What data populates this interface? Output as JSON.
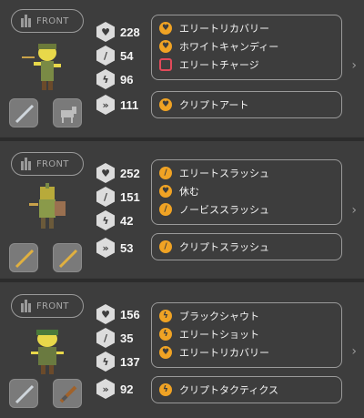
{
  "units": [
    {
      "position_label": "FRONT",
      "stats": {
        "hp": "228",
        "atk": "54",
        "spd": "96",
        "crit": "111"
      },
      "skills": [
        {
          "label": "エリートリカバリー",
          "icon": "heart-icon"
        },
        {
          "label": "ホワイトキャンディー",
          "icon": "heart-icon"
        },
        {
          "label": "エリートチャージ",
          "icon": "charge-icon"
        }
      ],
      "crypt_skill": {
        "label": "クリプトアート",
        "icon": "heart-icon"
      }
    },
    {
      "position_label": "FRONT",
      "stats": {
        "hp": "252",
        "atk": "151",
        "spd": "42",
        "crit": "53"
      },
      "skills": [
        {
          "label": "エリートスラッシュ",
          "icon": "sword-icon"
        },
        {
          "label": "休む",
          "icon": "heart-icon"
        },
        {
          "label": "ノービススラッシュ",
          "icon": "sword-icon"
        }
      ],
      "crypt_skill": {
        "label": "クリプトスラッシュ",
        "icon": "sword-icon"
      }
    },
    {
      "position_label": "FRONT",
      "stats": {
        "hp": "156",
        "atk": "35",
        "spd": "137",
        "crit": "92"
      },
      "skills": [
        {
          "label": "ブラックシャウト",
          "icon": "bolt-icon"
        },
        {
          "label": "エリートショット",
          "icon": "bolt-icon"
        },
        {
          "label": "エリートリカバリー",
          "icon": "heart-icon"
        }
      ],
      "crypt_skill": {
        "label": "クリプトタクティクス",
        "icon": "bolt-icon"
      }
    }
  ],
  "colors": {
    "accent": "#f0a324",
    "special": "#e24a5a"
  }
}
